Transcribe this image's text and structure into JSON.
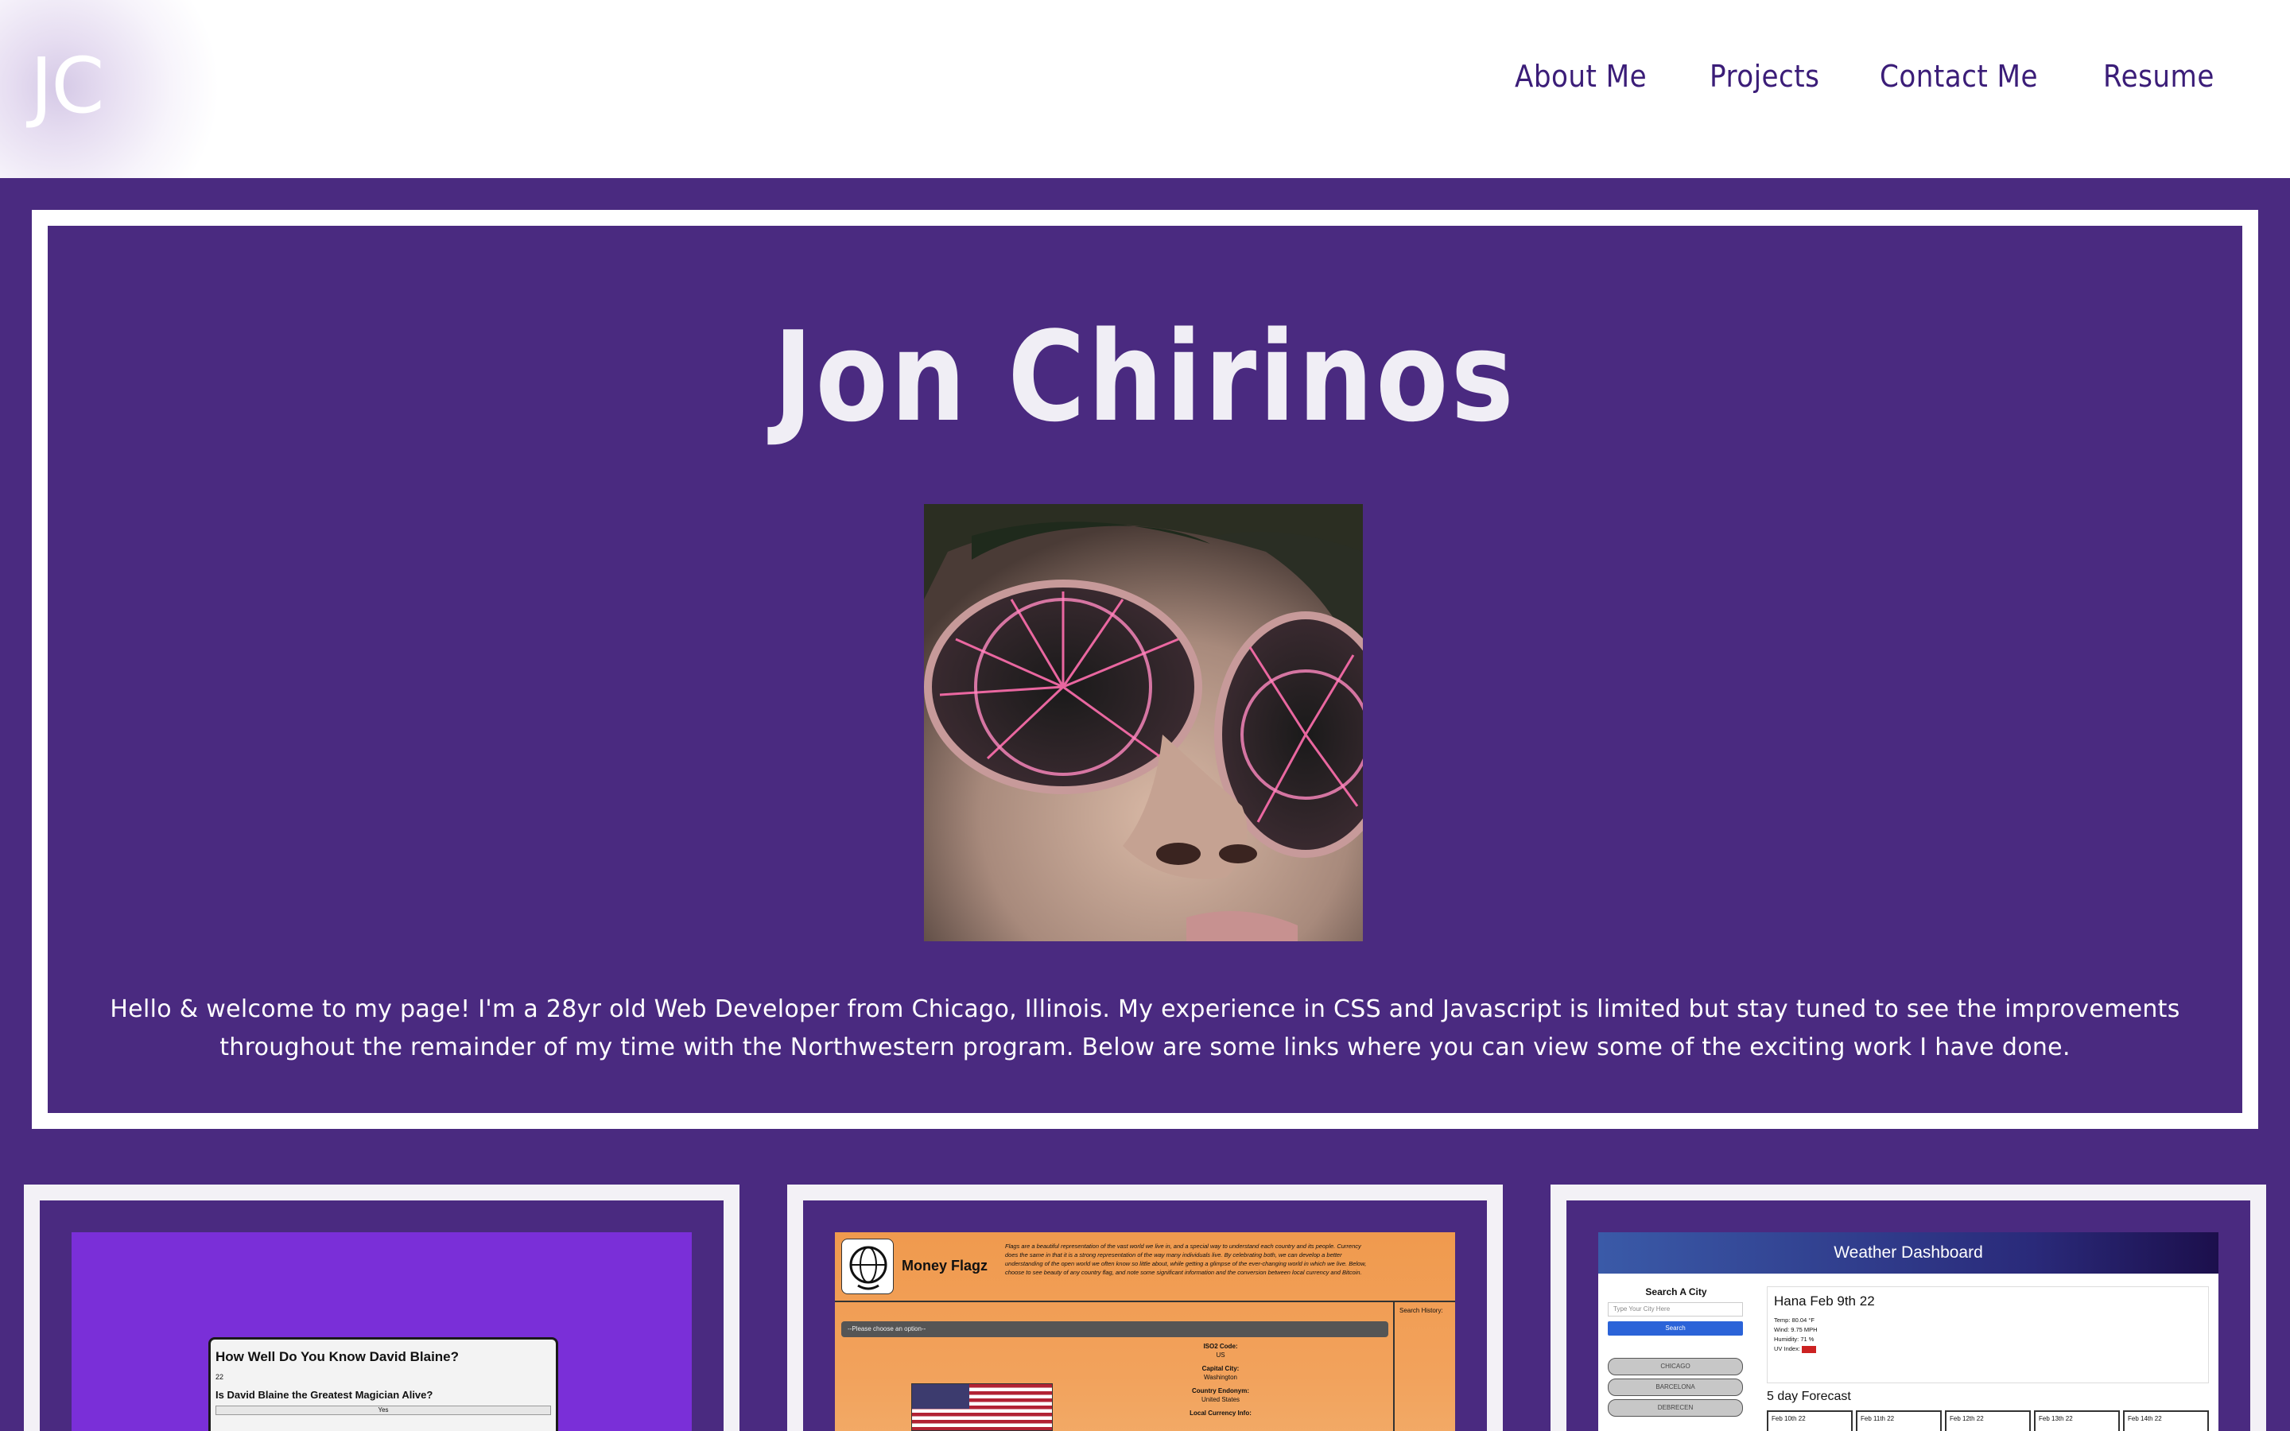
{
  "header": {
    "logo": "JC",
    "nav": [
      "About Me",
      "Projects",
      "Contact Me",
      "Resume"
    ]
  },
  "hero": {
    "title": "Jon Chirinos",
    "intro": "Hello & welcome to my page! I'm a 28yr old Web Developer from Chicago, Illinois. My experience in CSS and Javascript is limited but stay tuned to see the improvements throughout the remainder of my time with the Northwestern program. Below are some links where you can view some of the exciting work I have done."
  },
  "projects": {
    "quiz": {
      "title": "How Well Do You Know David Blaine?",
      "count": "22",
      "question": "Is David Blaine the Greatest Magician Alive?",
      "answer": "Yes"
    },
    "flags": {
      "name": "Money Flagz",
      "description": "Flags are a beautiful representation of the vast world we live in, and a special way to understand each country and its people. Currency does the same in that it is a strong representation of the way many individuals live. By celebrating both, we can develop a better understanding of the open world we often know so little about, while getting a glimpse of the ever-changing world in which we live. Below, choose to see beauty of any country flag, and note some significant information and the conversion between local currency and Bitcoin.",
      "select_placeholder": "--Please choose an option--",
      "search_history": "Search History:",
      "iso_label": "ISO2 Code:",
      "iso_value": "US",
      "capital_label": "Capital City:",
      "capital_value": "Washington",
      "demonym_label": "Country Endonym:",
      "demonym_value": "United States",
      "currency_label": "Local Currency Info:"
    },
    "weather": {
      "title": "Weather Dashboard",
      "search_title": "Search A City",
      "input_placeholder": "Type Your City Here",
      "search_button": "Search",
      "cities": [
        "CHICAGO",
        "BARCELONA",
        "DEBRECEN"
      ],
      "current_city": "Hana Feb 9th 22",
      "temp": "Temp: 80.04 °F",
      "wind": "Wind: 9.75 MPH",
      "humidity": "Humidity: 71 %",
      "uv": "UV Index:",
      "forecast_title": "5 day Forecast",
      "forecast_days": [
        "Feb 10th 22",
        "Feb 11th 22",
        "Feb 12th 22",
        "Feb 13th 22",
        "Feb 14th 22"
      ]
    }
  },
  "colors": {
    "background": "#4a2a80",
    "nav_text": "#3b1d78",
    "frame": "#ffffff",
    "quiz_bg": "#7a2fd8",
    "flags_bg": "#f2a25c"
  }
}
